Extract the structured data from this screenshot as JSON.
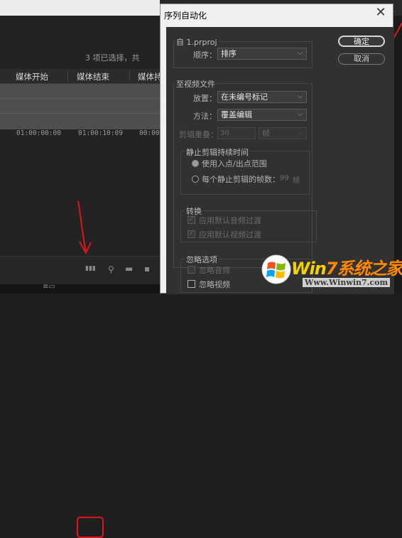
{
  "project_panel": {
    "selection_status": "3 项已选择，共",
    "columns": [
      "媒体开始",
      "媒体结束",
      "媒体持"
    ],
    "timecodes": [
      "01:00:00:00",
      "01:00:10:09",
      "00:00"
    ]
  },
  "dialog": {
    "title": "序列自动化",
    "close_glyph": "✕",
    "from_group": {
      "title": "自 1.prproj",
      "order_label": "顺序：",
      "order_value": "排序"
    },
    "to_group": {
      "title": "至视频文件",
      "placement_label": "放置：",
      "placement_value": "在未编号标记",
      "method_label": "方法：",
      "method_value": "覆盖编辑",
      "overlap_label": "剪辑重叠：",
      "overlap_value": "30",
      "overlap_unit": "帧"
    },
    "still_group": {
      "title": "静止剪辑持续时间",
      "option_inout": "使用入点/出点范围",
      "option_frames": "每个静止剪辑的帧数：",
      "frames_value": "99",
      "frames_unit": "帧"
    },
    "transition_group": {
      "title": "转换",
      "apply_audio": "应用默认音频过渡",
      "apply_video": "应用默认视频过渡"
    },
    "ignore_group": {
      "title": "忽略选项",
      "ignore_audio": "忽略音频",
      "ignore_video": "忽略视频"
    },
    "ok_label": "确定",
    "cancel_label": "取消"
  },
  "watermark": {
    "brand_part1": "Win",
    "brand_part2": "7系统之家",
    "url": "Www.Winwin7.com"
  },
  "colors": {
    "annotation_red": "#e0151c",
    "watermark_yellow": "#f4d000",
    "dialog_bg": "#313131"
  }
}
